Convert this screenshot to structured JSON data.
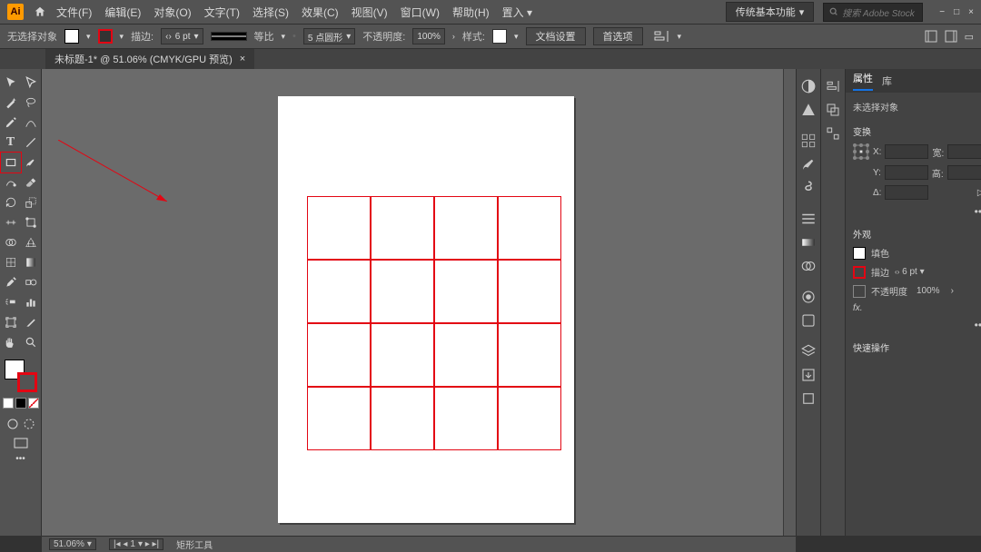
{
  "app": {
    "logo_text": "Ai"
  },
  "menus": {
    "file": "文件(F)",
    "edit": "编辑(E)",
    "object": "对象(O)",
    "text": "文字(T)",
    "select": "选择(S)",
    "effect": "效果(C)",
    "view": "视图(V)",
    "window": "窗口(W)",
    "help": "帮助(H)",
    "arrange": "置入 ▾"
  },
  "workspace": {
    "name": "传统基本功能",
    "search_placeholder": "搜索 Adobe Stock"
  },
  "optbar": {
    "noselection": "无选择对象",
    "stroke_label": "描边:",
    "stroke_value": "6 pt",
    "uniform": "等比",
    "corner_label": "5 点圆形",
    "opacity_label": "不透明度:",
    "opacity_value": "100%",
    "style_label": "样式:",
    "docsetup": "文档设置",
    "prefs": "首选项"
  },
  "tab": {
    "title": "未标题-1* @ 51.06% (CMYK/GPU 预览)",
    "close": "×"
  },
  "props": {
    "tab_properties": "属性",
    "tab_libraries": "库",
    "no_sel": "未选择对象",
    "transform_header": "变换",
    "x_label": "X:",
    "w_label": "宽:",
    "y_label": "Y:",
    "h_label": "高:",
    "angle_label": "Δ:",
    "appearance_header": "外观",
    "fill_label": "填色",
    "stroke_label": "描边",
    "stroke_val": "6 pt",
    "opacity_label": "不透明度",
    "opacity_val": "100%",
    "fx": "fx.",
    "quick_header": "快速操作"
  },
  "status": {
    "zoom": "51.06%",
    "artboard_nav": "1",
    "tool": "矩形工具"
  },
  "chart_data": {
    "type": "grid",
    "rows": 4,
    "cols": 4,
    "stroke_color": "#e30613",
    "fill_color": "#ffffff",
    "cell_size_px": 70
  }
}
